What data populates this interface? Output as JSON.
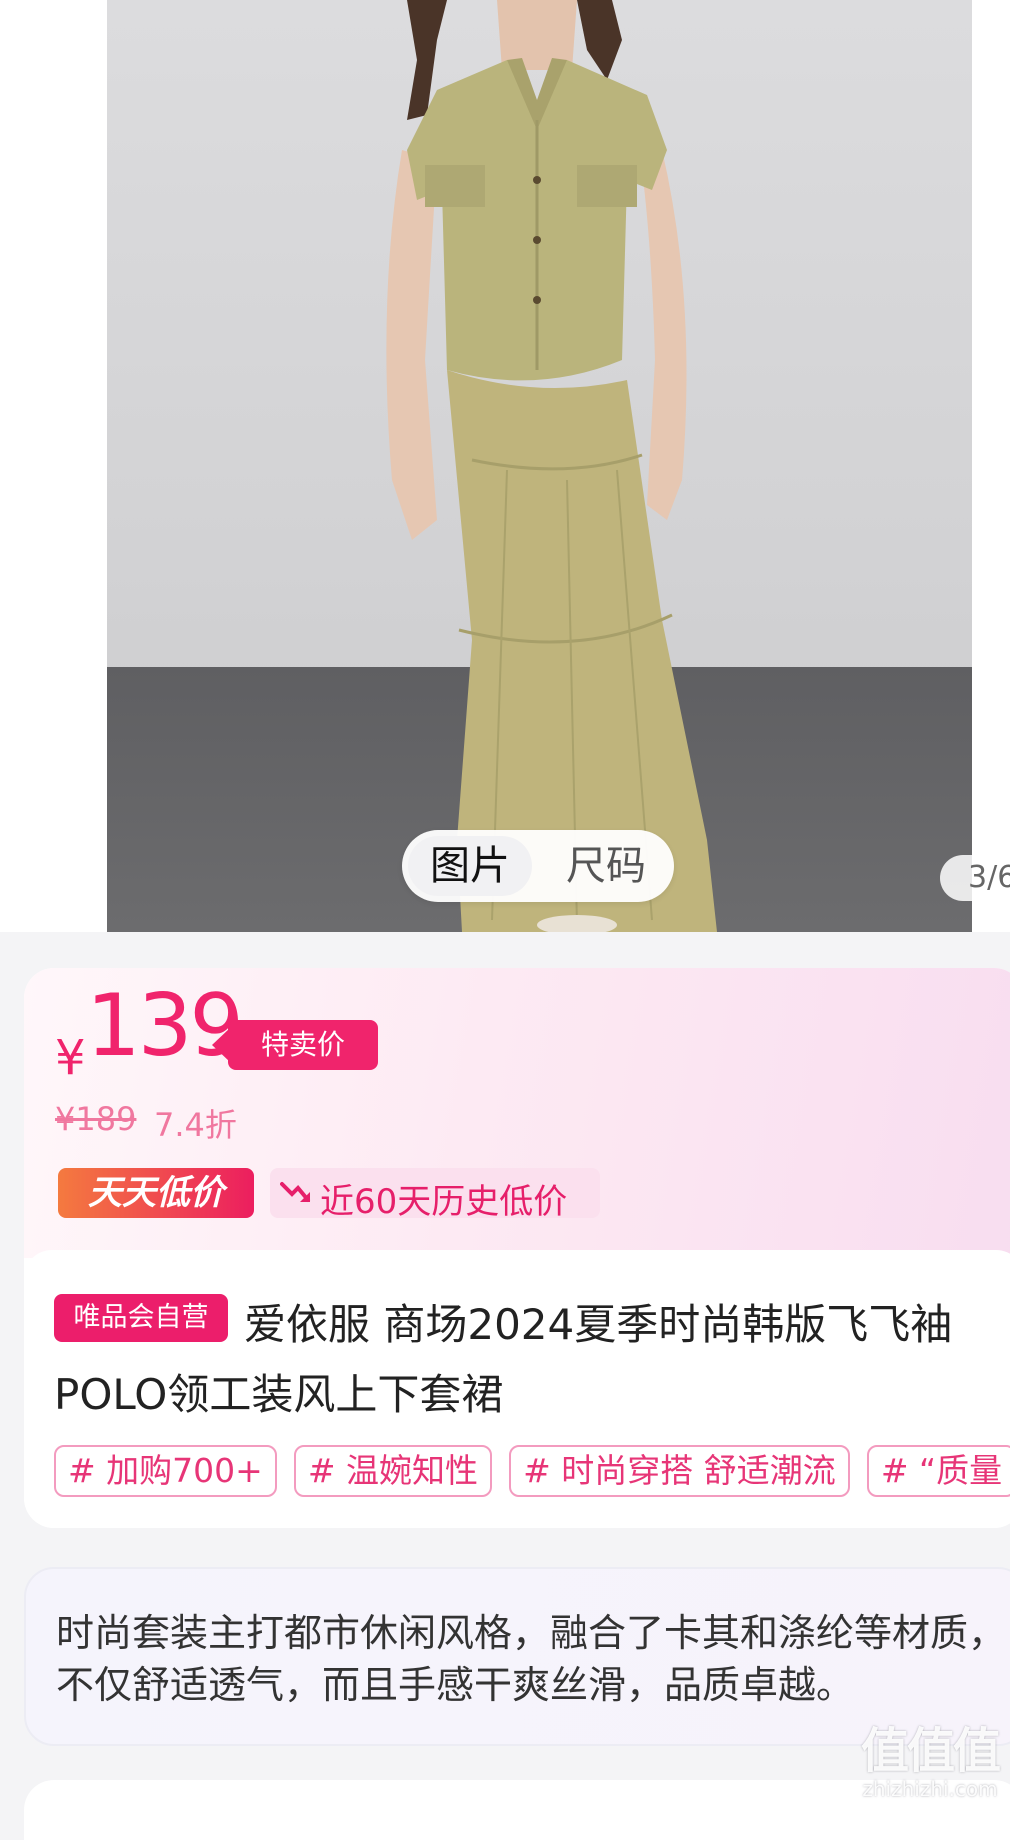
{
  "gallery": {
    "tabs": [
      {
        "label": "图片",
        "active": true
      },
      {
        "label": "尺码",
        "active": false
      }
    ],
    "counter": "3/6"
  },
  "price": {
    "currency": "¥",
    "value": "139",
    "badge": "特卖价",
    "original": "¥189",
    "discount": "7.4折",
    "daily_badge": "天天低价",
    "history_badge": "近60天历史低价",
    "accent_color": "#f0246c"
  },
  "product": {
    "store_tag": "唯品会自营",
    "title": "爱依服 商场2024夏季时尚韩版飞飞袖POLO领工装风上下套裙",
    "tags": [
      "# 加购700+",
      "# 温婉知性",
      "# 时尚穿搭 舒适潮流",
      "# “质量"
    ]
  },
  "description": {
    "text": "时尚套装主打都市休闲风格，融合了卡其和涤纶等材质，不仅舒适透气，而且手感干爽丝滑，品质卓越。"
  },
  "watermark": {
    "logo": "值值值",
    "url": "zhizhizhi.com"
  }
}
